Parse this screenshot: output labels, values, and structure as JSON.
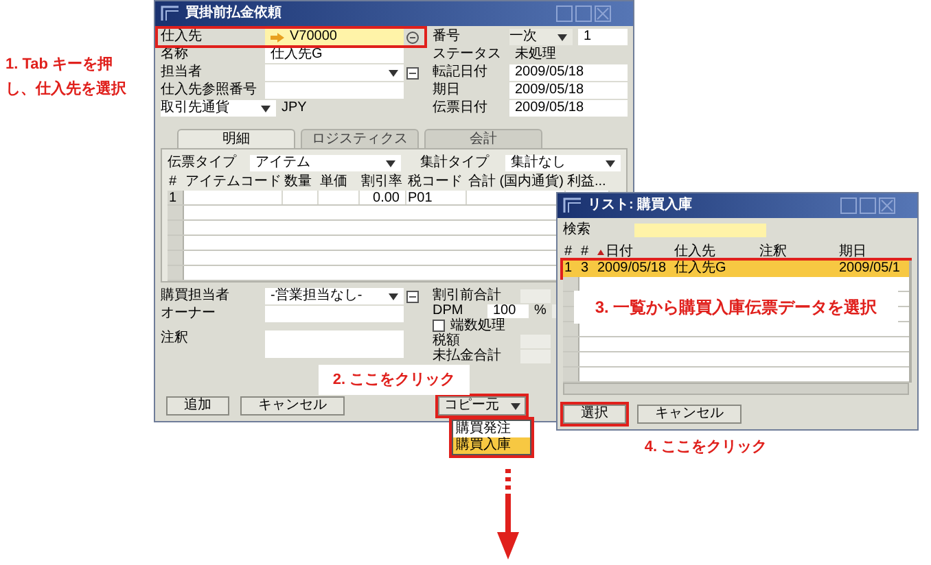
{
  "callouts": [
    "1. Tab キーを押し、仕入先を選択",
    "2. ここをクリック",
    "3. 一覧から購買入庫伝票データを選択",
    "4. ここをクリック"
  ],
  "main_window": {
    "title": "買掛前払金依頼",
    "header_left": [
      {
        "label": "仕入先",
        "value": "V70000",
        "kind": "link",
        "focused": true
      },
      {
        "label": "名称",
        "value": "仕入先G",
        "kind": "text",
        "focused": false
      },
      {
        "label": "担当者",
        "kind": "dropdown",
        "focused": false
      },
      {
        "label": "仕入先参照番号",
        "kind": "text",
        "focused": false
      },
      {
        "label": "取引先通貨",
        "value": "JPY",
        "kind": "label_select",
        "focused": false
      }
    ],
    "header_right": [
      {
        "label": "番号",
        "series": "一次",
        "value": "1",
        "kind": "series"
      },
      {
        "label": "ステータス",
        "value": "未処理",
        "kind": "plain"
      },
      {
        "label": "転記日付",
        "value": "2009/05/18",
        "kind": "text"
      },
      {
        "label": "期日",
        "value": "2009/05/18",
        "kind": "text"
      },
      {
        "label": "伝票日付",
        "value": "2009/05/18",
        "kind": "text"
      }
    ],
    "tabs": [
      {
        "label": "明細",
        "selected": true
      },
      {
        "label": "ロジスティクス",
        "selected": false
      },
      {
        "label": "会計",
        "selected": false
      }
    ],
    "document_type": {
      "label": "伝票タイプ",
      "value": "アイテム"
    },
    "summary_type": {
      "label": "集計タイプ",
      "value": "集計なし"
    },
    "table": {
      "columns": [
        "#",
        "アイテムコード",
        "数量",
        "単価",
        "割引率",
        "税コード",
        "合計 (国内通貨)",
        "利益..."
      ],
      "rows": [
        {
          "number": "1",
          "discount": "0.00",
          "tax_code": "P01"
        }
      ]
    },
    "footer_left": [
      {
        "label": "購買担当者",
        "value": "-営業担当なし-",
        "kind": "dropdown"
      },
      {
        "label": "オーナー",
        "kind": "text"
      },
      {
        "label": "注釈",
        "kind": "area"
      }
    ],
    "footer_right": [
      {
        "label": "割引前合計",
        "kind": "text"
      },
      {
        "label": "DPM",
        "value": "100",
        "suffix": "%",
        "kind": "percent"
      },
      {
        "label": "端数処理",
        "kind": "checkbox",
        "checked": false
      },
      {
        "label": "税額",
        "kind": "text"
      },
      {
        "label": "未払金合計",
        "kind": "text"
      }
    ],
    "buttons": [
      "追加",
      "キャンセル"
    ],
    "copy_from": {
      "label": "コピー元",
      "options": [
        {
          "label": "購買発注",
          "selected": false
        },
        {
          "label": "購買入庫",
          "selected": true
        }
      ]
    }
  },
  "popup": {
    "title": "リスト: 購買入庫",
    "search": {
      "label": "検索"
    },
    "columns": [
      {
        "label": "#",
        "sorted": false
      },
      {
        "label": "#",
        "sorted": false
      },
      {
        "label": "日付",
        "sorted": true
      },
      {
        "label": "仕入先",
        "sorted": false
      },
      {
        "label": "注釈",
        "sorted": false
      },
      {
        "label": "期日",
        "sorted": false
      }
    ],
    "rows": [
      {
        "cells": [
          "1",
          "3",
          "2009/05/18",
          "仕入先G",
          null,
          "2009/05/1"
        ],
        "selected": true
      }
    ],
    "buttons": [
      "選択",
      "キャンセル"
    ]
  }
}
